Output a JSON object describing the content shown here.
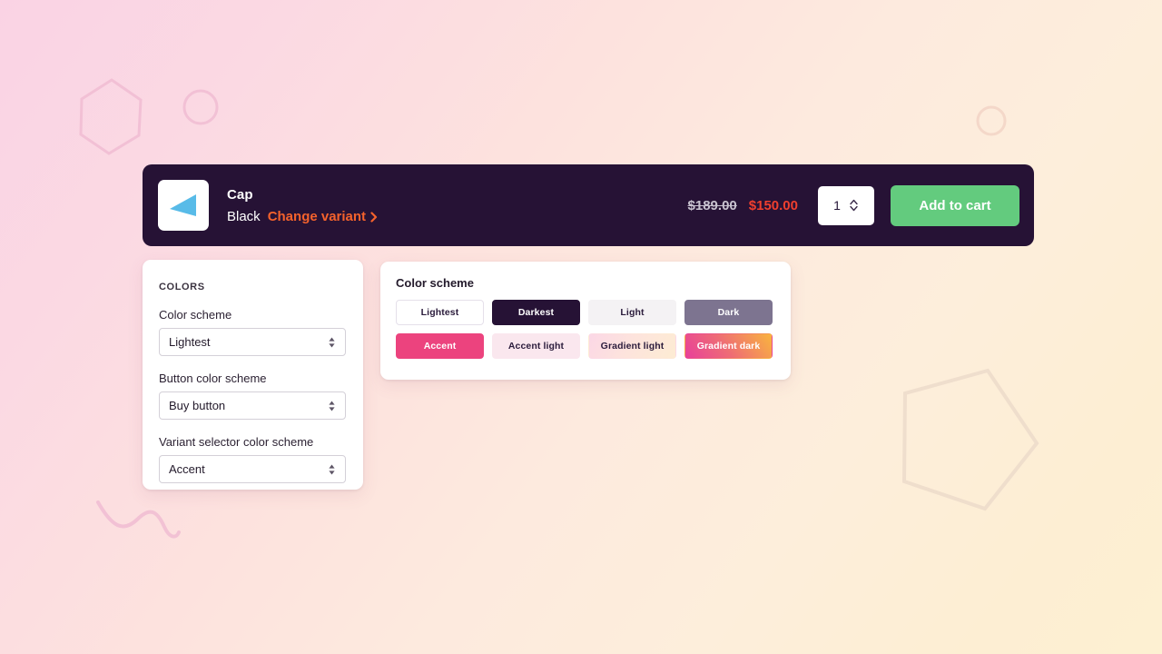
{
  "background": {
    "gradient_from": "#fad3e4",
    "gradient_to": "#fdf0d2",
    "shapes": [
      {
        "name": "hexagon-outline",
        "position": "top-left"
      },
      {
        "name": "circle-outline",
        "position": "top-left"
      },
      {
        "name": "circle-outline-small",
        "position": "top-right"
      },
      {
        "name": "pentagon-outline",
        "position": "bottom-right"
      },
      {
        "name": "squiggle-line",
        "position": "bottom-left"
      }
    ]
  },
  "product_bar": {
    "background_color": "#261235",
    "thumbnail_icon": "blue-triangle-product-image",
    "title": "Cap",
    "variant": "Black",
    "change_variant_label": "Change variant",
    "change_variant_color": "#f4622c",
    "price_original": "$189.00",
    "price_sale": "$150.00",
    "price_sale_color": "#f03f2e",
    "quantity": "1",
    "add_to_cart_label": "Add to cart",
    "add_to_cart_color": "#63cb7e"
  },
  "settings_panel": {
    "section_label": "COLORS",
    "fields": [
      {
        "label": "Color scheme",
        "value": "Lightest"
      },
      {
        "label": "Button color scheme",
        "value": "Buy button"
      },
      {
        "label": "Variant selector color scheme",
        "value": "Accent"
      }
    ]
  },
  "swatch_panel": {
    "title": "Color scheme",
    "swatches": [
      {
        "label": "Lightest",
        "bg": "#ffffff",
        "text": "#2b1c3c",
        "border": "#e5e0ea",
        "gradient": ""
      },
      {
        "label": "Darkest",
        "bg": "#261235",
        "text": "#ffffff",
        "border": "#261235",
        "gradient": ""
      },
      {
        "label": "Light",
        "bg": "#f4f2f4",
        "text": "#2b1c3c",
        "border": "#f4f2f4",
        "gradient": ""
      },
      {
        "label": "Dark",
        "bg": "#7d7490",
        "text": "#ffffff",
        "border": "#7d7490",
        "gradient": ""
      },
      {
        "label": "Accent",
        "bg": "#ec437e",
        "text": "#ffffff",
        "border": "#ec437e",
        "gradient": ""
      },
      {
        "label": "Accent light",
        "bg": "#fae7ee",
        "text": "#2b1c3c",
        "border": "#fae7ee",
        "gradient": ""
      },
      {
        "label": "Gradient light",
        "bg": "#fce0e2",
        "text": "#2b1c3c",
        "border": "transparent",
        "gradient": "linear-gradient(120deg, #fbd7e6 0%, #fde3dd 45%, #fdecd3 100%)"
      },
      {
        "label": "Gradient dark",
        "bg": "#ef5fa0",
        "text": "#ffffff",
        "border": "transparent",
        "gradient": "linear-gradient(55deg, #e8409a 0%, #ee6b76 45%, #f9b43e 100%)"
      }
    ]
  }
}
